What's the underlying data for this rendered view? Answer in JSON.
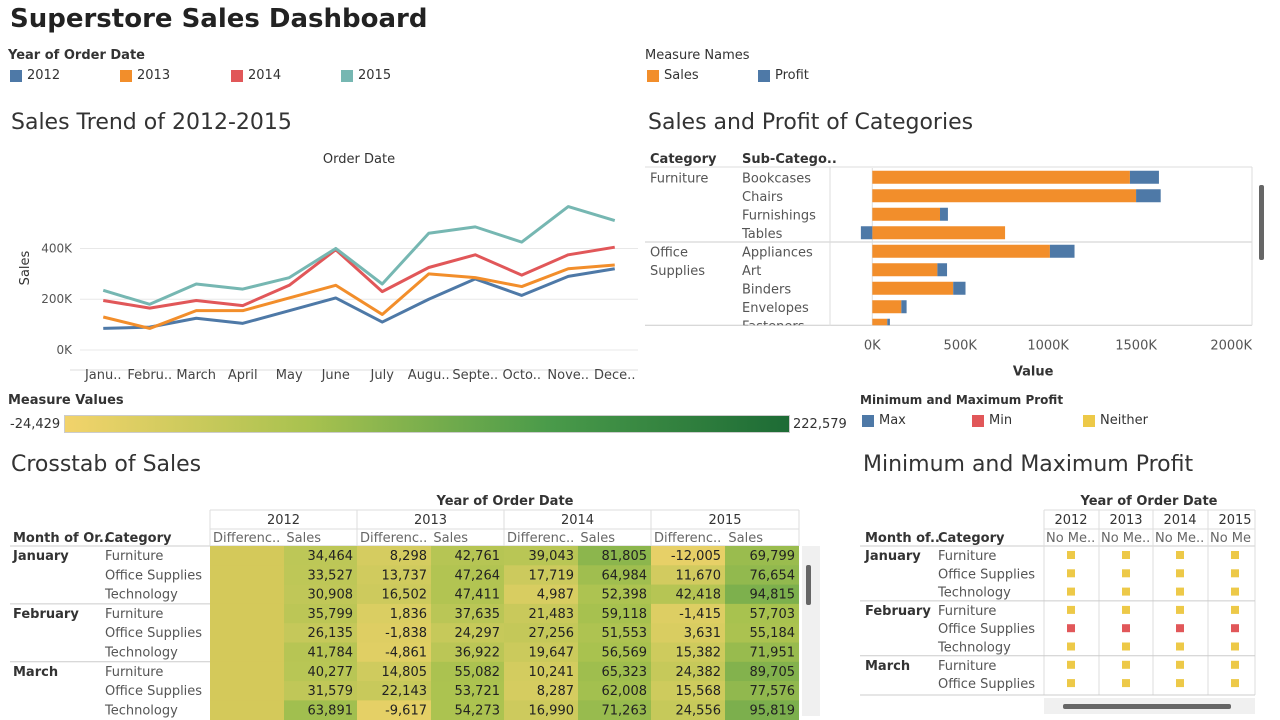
{
  "dashboard": {
    "title": "Superstore Sales Dashboard"
  },
  "colors": {
    "y2012": "#4e79a7",
    "y2013": "#f28e2b",
    "y2014": "#e15759",
    "y2015": "#76b7b2",
    "sales": "#f28e2b",
    "profit": "#4e79a7",
    "max": "#4e79a7",
    "min": "#e15759",
    "neither": "#edc948"
  },
  "year_legend": {
    "title": "Year of Order Date",
    "items": [
      "2012",
      "2013",
      "2014",
      "2015"
    ]
  },
  "measure_legend": {
    "title": "Measure Names",
    "items": [
      "Sales",
      "Profit"
    ]
  },
  "trend": {
    "title": "Sales Trend of 2012-2015",
    "chart_data": {
      "type": "line",
      "xlabel": "Order Date",
      "ylabel": "Sales",
      "categories": [
        "Janu..",
        "Febru..",
        "March",
        "April",
        "May",
        "June",
        "July",
        "Augu..",
        "Septe..",
        "Octo..",
        "Nove..",
        "Dece.."
      ],
      "yticks": [
        "0K",
        "200K",
        "400K"
      ],
      "ylim": [
        0,
        650000
      ],
      "series": [
        {
          "name": "2012",
          "values": [
            85000,
            90000,
            125000,
            105000,
            155000,
            205000,
            110000,
            200000,
            280000,
            215000,
            290000,
            320000
          ]
        },
        {
          "name": "2013",
          "values": [
            130000,
            85000,
            155000,
            155000,
            205000,
            255000,
            140000,
            300000,
            285000,
            250000,
            320000,
            335000
          ]
        },
        {
          "name": "2014",
          "values": [
            195000,
            165000,
            195000,
            175000,
            255000,
            395000,
            230000,
            325000,
            375000,
            295000,
            375000,
            405000
          ]
        },
        {
          "name": "2015",
          "values": [
            235000,
            180000,
            260000,
            240000,
            285000,
            400000,
            260000,
            460000,
            485000,
            425000,
            565000,
            510000
          ]
        }
      ]
    }
  },
  "catchart": {
    "title": "Sales and Profit of Categories",
    "col_category": "Category",
    "col_sub": "Sub-Catego..",
    "chart_data": {
      "type": "bar",
      "xlabel": "Value",
      "xticks": [
        "0K",
        "500K",
        "1000K",
        "1500K",
        "2000K"
      ],
      "xlim": [
        -70000,
        2000000
      ],
      "rows": [
        {
          "category": "Furniture",
          "sub": "Bookcases",
          "sales": 1465000,
          "profit": 165000
        },
        {
          "category": "",
          "sub": "Chairs",
          "sales": 1500000,
          "profit": 140000
        },
        {
          "category": "",
          "sub": "Furnishings",
          "sales": 385000,
          "profit": 45000
        },
        {
          "category": "",
          "sub": "Tables",
          "sales": 755000,
          "profit": -65000
        },
        {
          "category": "Office",
          "category2": "Supplies",
          "sub": "Appliances",
          "sales": 1010000,
          "profit": 140000
        },
        {
          "category": "",
          "sub": "Art",
          "sales": 370000,
          "profit": 55000
        },
        {
          "category": "",
          "sub": "Binders",
          "sales": 460000,
          "profit": 70000
        },
        {
          "category": "",
          "sub": "Envelopes",
          "sales": 165000,
          "profit": 30000
        },
        {
          "category": "",
          "sub": "Fasteners",
          "sales": 85000,
          "profit": 15000
        }
      ]
    }
  },
  "measure_values": {
    "title": "Measure Values",
    "min": "-24,429",
    "max": "222,579"
  },
  "minmax_legend": {
    "title": "Minimum and Maximum Profit",
    "items": [
      "Max",
      "Min",
      "Neither"
    ]
  },
  "crosstab": {
    "title": "Crosstab of Sales",
    "year_header": "Year of Order Date",
    "row_header_month": "Month of Or..",
    "row_header_cat": "Category",
    "years": [
      "2012",
      "2013",
      "2014",
      "2015"
    ],
    "col_diff": "Differenc..",
    "col_sales": "Sales",
    "rows": [
      {
        "month": "January",
        "category": "Furniture",
        "cells": [
          "",
          "34,464",
          "8,298",
          "42,761",
          "39,043",
          "81,805",
          "-12,005",
          "69,799"
        ]
      },
      {
        "month": "",
        "category": "Office Supplies",
        "cells": [
          "",
          "33,527",
          "13,737",
          "47,264",
          "17,719",
          "64,984",
          "11,670",
          "76,654"
        ]
      },
      {
        "month": "",
        "category": "Technology",
        "cells": [
          "",
          "30,908",
          "16,502",
          "47,411",
          "4,987",
          "52,398",
          "42,418",
          "94,815"
        ]
      },
      {
        "month": "February",
        "category": "Furniture",
        "cells": [
          "",
          "35,799",
          "1,836",
          "37,635",
          "21,483",
          "59,118",
          "-1,415",
          "57,703"
        ]
      },
      {
        "month": "",
        "category": "Office Supplies",
        "cells": [
          "",
          "26,135",
          "-1,838",
          "24,297",
          "27,256",
          "51,553",
          "3,631",
          "55,184"
        ]
      },
      {
        "month": "",
        "category": "Technology",
        "cells": [
          "",
          "41,784",
          "-4,861",
          "36,922",
          "19,647",
          "56,569",
          "15,382",
          "71,951"
        ]
      },
      {
        "month": "March",
        "category": "Furniture",
        "cells": [
          "",
          "40,277",
          "14,805",
          "55,082",
          "10,241",
          "65,323",
          "24,382",
          "89,705"
        ]
      },
      {
        "month": "",
        "category": "Office Supplies",
        "cells": [
          "",
          "31,579",
          "22,143",
          "53,721",
          "8,287",
          "62,008",
          "15,568",
          "77,576"
        ]
      },
      {
        "month": "",
        "category": "Technology",
        "cells": [
          "",
          "63,891",
          "-9,617",
          "54,273",
          "16,990",
          "71,263",
          "24,556",
          "95,819"
        ]
      }
    ]
  },
  "minmax": {
    "title": "Minimum and Maximum Profit",
    "year_header": "Year of Order Date",
    "row_header_month": "Month of..",
    "row_header_cat": "Category",
    "years": [
      "2012",
      "2013",
      "2014",
      "2015"
    ],
    "col_labels": [
      "No Me..",
      "No Me..",
      "No Me..",
      "No Me"
    ],
    "rows": [
      {
        "month": "January",
        "category": "Furniture",
        "flags": [
          "Neither",
          "Neither",
          "Neither",
          "Neither"
        ]
      },
      {
        "month": "",
        "category": "Office Supplies",
        "flags": [
          "Neither",
          "Neither",
          "Neither",
          "Neither"
        ]
      },
      {
        "month": "",
        "category": "Technology",
        "flags": [
          "Neither",
          "Neither",
          "Neither",
          "Neither"
        ]
      },
      {
        "month": "February",
        "category": "Furniture",
        "flags": [
          "Neither",
          "Neither",
          "Neither",
          "Neither"
        ]
      },
      {
        "month": "",
        "category": "Office Supplies",
        "flags": [
          "Min",
          "Min",
          "Min",
          "Min"
        ]
      },
      {
        "month": "",
        "category": "Technology",
        "flags": [
          "Neither",
          "Neither",
          "Neither",
          "Neither"
        ]
      },
      {
        "month": "March",
        "category": "Furniture",
        "flags": [
          "Neither",
          "Neither",
          "Neither",
          "Neither"
        ]
      },
      {
        "month": "",
        "category": "Office Supplies",
        "flags": [
          "Neither",
          "Neither",
          "Neither",
          "Neither"
        ]
      }
    ]
  }
}
